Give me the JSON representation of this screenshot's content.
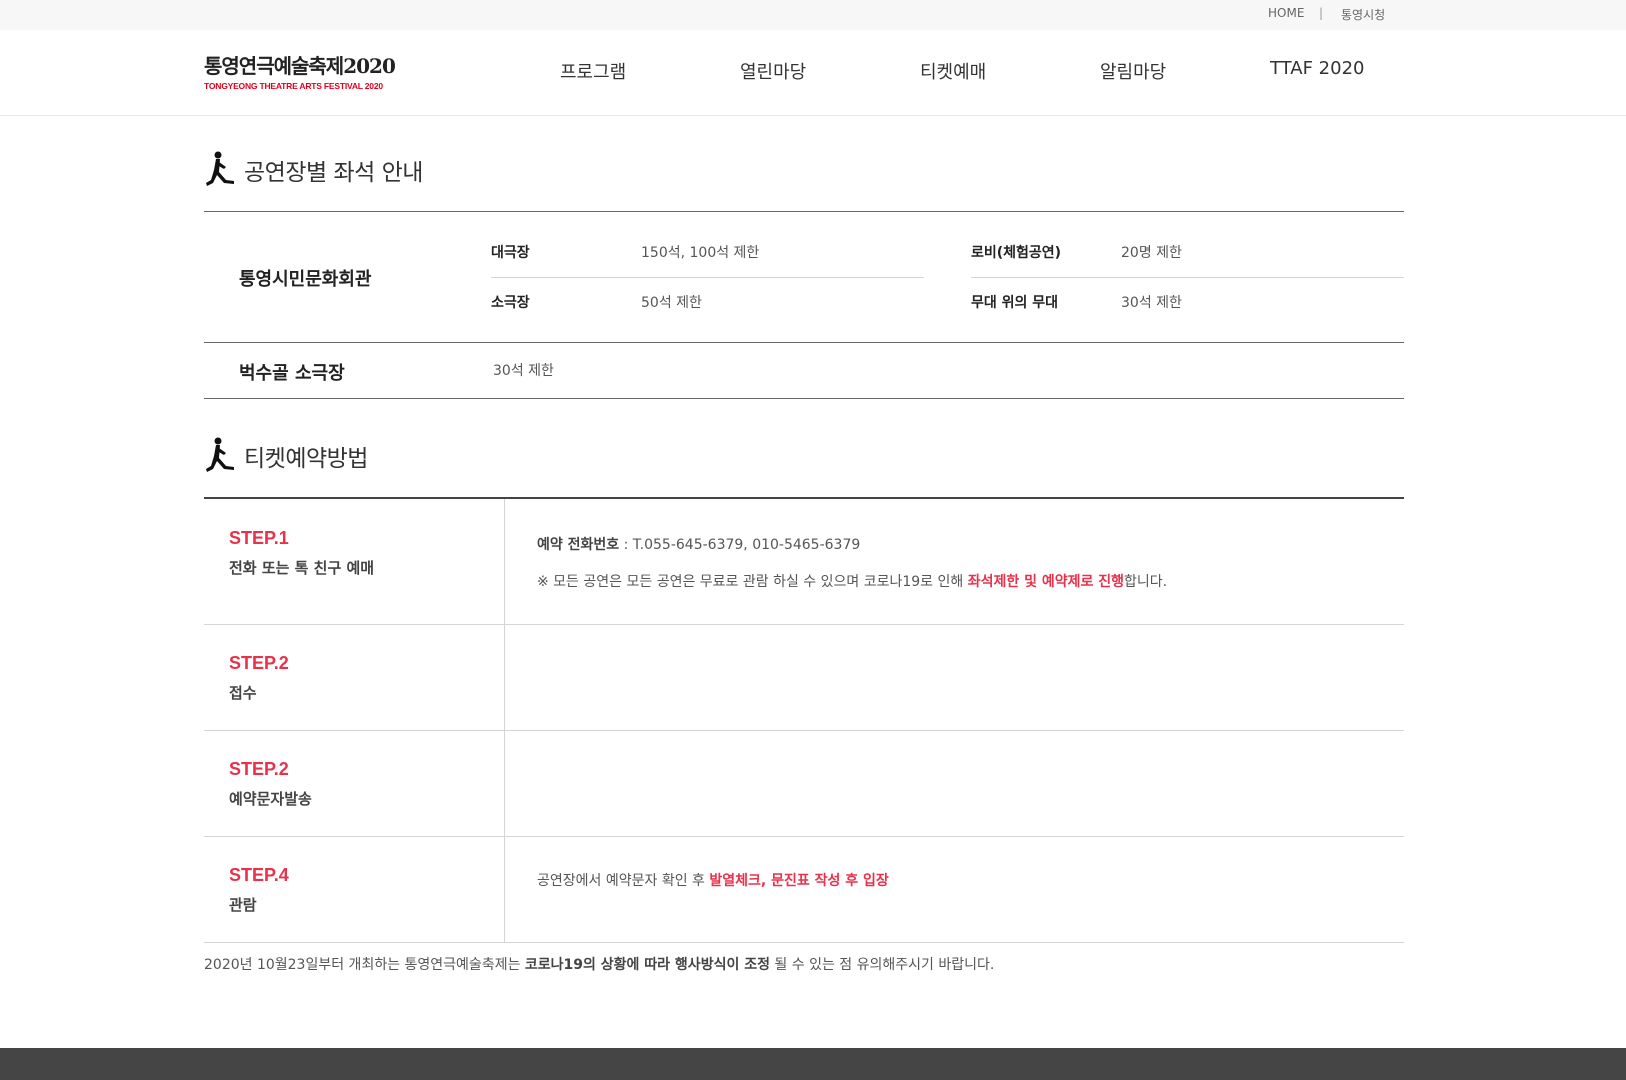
{
  "utility": {
    "home": "HOME",
    "separator": "|",
    "city": "통영시청"
  },
  "logo": {
    "title": "통영연극예술축제2020",
    "subtitle": "TONGYEONG THEATRE ARTS FESTIVAL 2020"
  },
  "nav": [
    "프로그램",
    "열린마당",
    "티켓예매",
    "알림마당",
    "TTAF 2020"
  ],
  "seating": {
    "title": "공연장별 좌석 안내",
    "venue1": {
      "name": "통영시민문화회관",
      "halls": [
        {
          "label": "대극장",
          "value": "150석, 100석 제한"
        },
        {
          "label": "로비(체험공연)",
          "value": "20명 제한"
        },
        {
          "label": "소극장",
          "value": "50석 제한"
        },
        {
          "label": "무대 위의 무대",
          "value": "30석 제한"
        }
      ]
    },
    "venue2": {
      "name": "벅수골 소극장",
      "value": "30석 제한"
    }
  },
  "booking": {
    "title": "티켓예약방법",
    "steps": [
      {
        "no": "STEP.1",
        "name": "전화 또는 톡 친구 예매"
      },
      {
        "no": "STEP.2",
        "name": "접수"
      },
      {
        "no": "STEP.2",
        "name": "예약문자발송"
      },
      {
        "no": "STEP.4",
        "name": "관람"
      }
    ],
    "step1": {
      "phone_label": "예약 전화번호",
      "phone_value": " : T.055-645-6379, 010-5465-6379",
      "note_before": "※ 모든 공연은 모든 공연은 무료로 관람 하실 수 있으며 코로나19로 인해 ",
      "note_highlight": "좌석제한 및 예약제로 진행",
      "note_after": "합니다."
    },
    "step4": {
      "before": "공연장에서 예약문자 확인 후 ",
      "highlight": "발열체크, 문진표 작성 후 입장"
    }
  },
  "notice": {
    "before": "2020년 10월23일부터 개최하는 통영연극예술축제는 ",
    "bold": "코로나19의 상황에 따라 행사방식이 조정",
    "after": " 될 수 있는 점 유의해주시기 바랍니다."
  },
  "colors": {
    "accent": "#e8314a",
    "footer": "#454545",
    "topbar": "#f7f7f7"
  },
  "icons": [
    "runner-icon"
  ]
}
